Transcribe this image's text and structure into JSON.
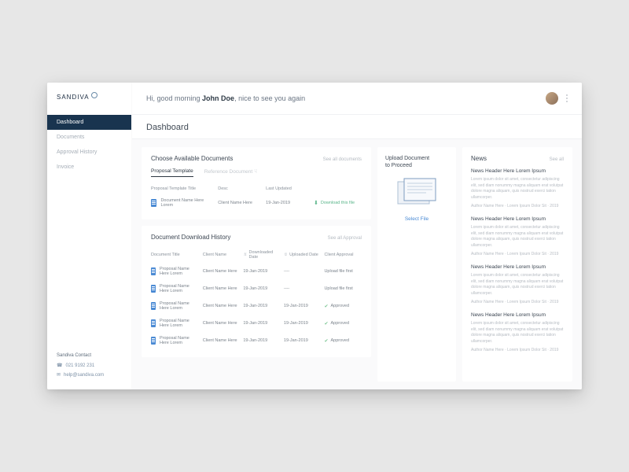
{
  "brand": {
    "name": "SANDIVA"
  },
  "greeting": {
    "pre": "Hi, good morning ",
    "name": "John Doe",
    "post": ", nice to see you again"
  },
  "page_title": "Dashboard",
  "sidebar": {
    "items": [
      {
        "label": "Dashboard"
      },
      {
        "label": "Documents"
      },
      {
        "label": "Approval History"
      },
      {
        "label": "Invoice"
      }
    ],
    "contact_title": "Sandiva Contact",
    "phone": "021 9192 231",
    "email": "help@sandiva.com"
  },
  "documents": {
    "title": "Choose Available Documents",
    "see_all": "See all documents",
    "tabs": [
      {
        "label": "Proposal Template"
      },
      {
        "label": "Reference Document"
      }
    ],
    "columns": {
      "c1": "Proposal Template Title",
      "c2": "Desc",
      "c3": "Last Updated",
      "c4": ""
    },
    "row": {
      "title": "Document Name Here Lorem",
      "desc": "Client Name Here",
      "updated": "19-Jan-2019",
      "action": "Download this file"
    }
  },
  "history": {
    "title": "Document Download History",
    "see_all": "See all Approval",
    "columns": {
      "c1": "Document Title",
      "c2": "Client Name",
      "c3": "Downloaded Date",
      "c4": "Uploaded Date",
      "c5": "Client Approval"
    },
    "rows": [
      {
        "title": "Proposal Name Here Lorem",
        "client": "Client Name Here",
        "dl": "19-Jan-2019",
        "up": "----",
        "appr": "Upload file first",
        "ok": false
      },
      {
        "title": "Proposal Name Here Lorem",
        "client": "Client Name Here",
        "dl": "19-Jan-2019",
        "up": "----",
        "appr": "Upload file first",
        "ok": false
      },
      {
        "title": "Proposal Name Here Lorem",
        "client": "Client Name Here",
        "dl": "19-Jan-2019",
        "up": "19-Jan-2019",
        "appr": "Approved",
        "ok": true
      },
      {
        "title": "Proposal Name Here Lorem",
        "client": "Client Name Here",
        "dl": "19-Jan-2019",
        "up": "19-Jan-2019",
        "appr": "Approved",
        "ok": true
      },
      {
        "title": "Proposal Name Here Lorem",
        "client": "Client Name Here",
        "dl": "19-Jan-2019",
        "up": "19-Jan-2019",
        "appr": "Approved",
        "ok": true
      }
    ]
  },
  "upload": {
    "title1": "Upload Document",
    "title2": "to Proceed",
    "button": "Select File"
  },
  "news": {
    "title": "News",
    "see_all": "See all",
    "items": [
      {
        "title": "News Header Here Lorem Ipsum",
        "body": "Lorem ipsum dolor sit amet, consectetur adipiscing elit, sed diam nonummy magna aliquam erat volutpat dolore magna aliquam, quis nostrud exerci tation ullamcorper.",
        "meta": "Author Name Here · Lorem Ipsum Dolor Sit · 2019"
      },
      {
        "title": "News Header Here Lorem Ipsum",
        "body": "Lorem ipsum dolor sit amet, consectetur adipiscing elit, sed diam nonummy magna aliquam erat volutpat dolore magna aliquam, quis nostrud exerci tation ullamcorper.",
        "meta": "Author Name Here · Lorem Ipsum Dolor Sit · 2019"
      },
      {
        "title": "News Header Here Lorem Ipsum",
        "body": "Lorem ipsum dolor sit amet, consectetur adipiscing elit, sed diam nonummy magna aliquam erat volutpat dolore magna aliquam, quis nostrud exerci tation ullamcorper.",
        "meta": "Author Name Here · Lorem Ipsum Dolor Sit · 2019"
      },
      {
        "title": "News Header Here Lorem Ipsum",
        "body": "Lorem ipsum dolor sit amet, consectetur adipiscing elit, sed diam nonummy magna aliquam erat volutpat dolore magna aliquam, quis nostrud exerci tation ullamcorper.",
        "meta": "Author Name Here · Lorem Ipsum Dolor Sit · 2019"
      }
    ]
  }
}
